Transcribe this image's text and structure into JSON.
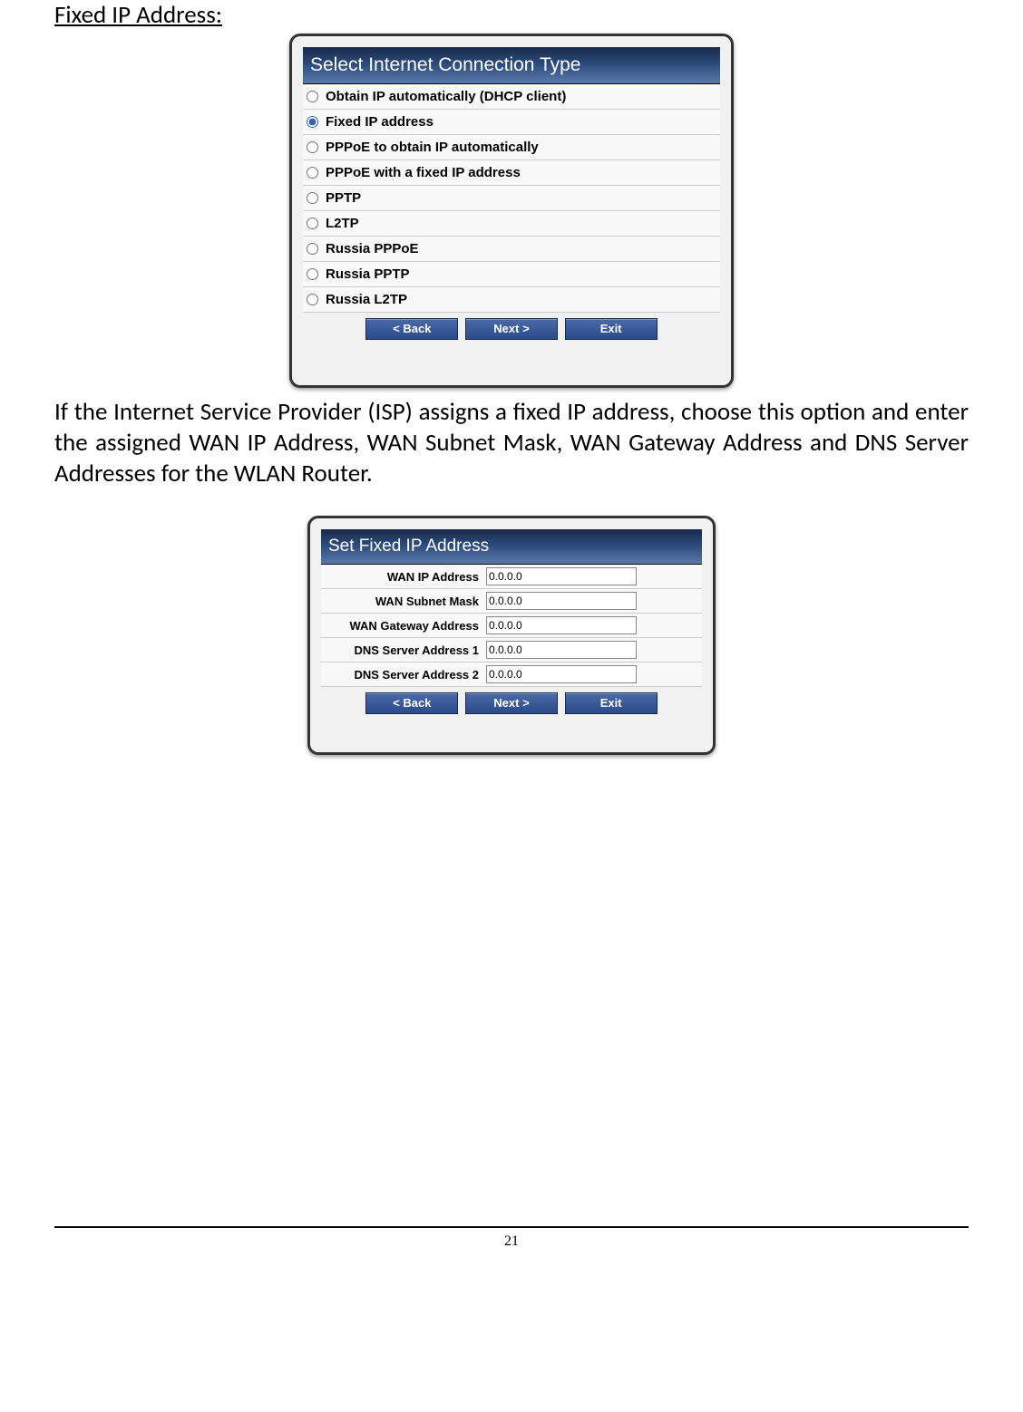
{
  "heading": "Fixed IP Address:",
  "panel1": {
    "title": "Select Internet Connection Type",
    "options": [
      "Obtain IP automatically (DHCP client)",
      "Fixed IP address",
      "PPPoE to obtain IP automatically",
      "PPPoE with a fixed IP address",
      "PPTP",
      "L2TP",
      "Russia PPPoE",
      "Russia PPTP",
      "Russia L2TP"
    ],
    "selected_index": 1,
    "buttons": {
      "back": "<  Back",
      "next": "Next  >",
      "exit": "Exit"
    }
  },
  "body_paragraph": "If the Internet Service Provider (ISP) assigns a fixed IP address, choose this option and enter the assigned WAN IP Address, WAN Subnet Mask, WAN Gateway Address and DNS Server Addresses for the WLAN Router.",
  "panel2": {
    "title": "Set Fixed IP Address",
    "fields": [
      {
        "label": "WAN IP Address",
        "value": "0.0.0.0"
      },
      {
        "label": "WAN Subnet Mask",
        "value": "0.0.0.0"
      },
      {
        "label": "WAN Gateway Address",
        "value": "0.0.0.0"
      },
      {
        "label": "DNS Server Address 1",
        "value": "0.0.0.0"
      },
      {
        "label": "DNS Server Address 2",
        "value": "0.0.0.0"
      }
    ],
    "buttons": {
      "back": "<  Back",
      "next": "Next  >",
      "exit": "Exit"
    }
  },
  "page_number": "21"
}
